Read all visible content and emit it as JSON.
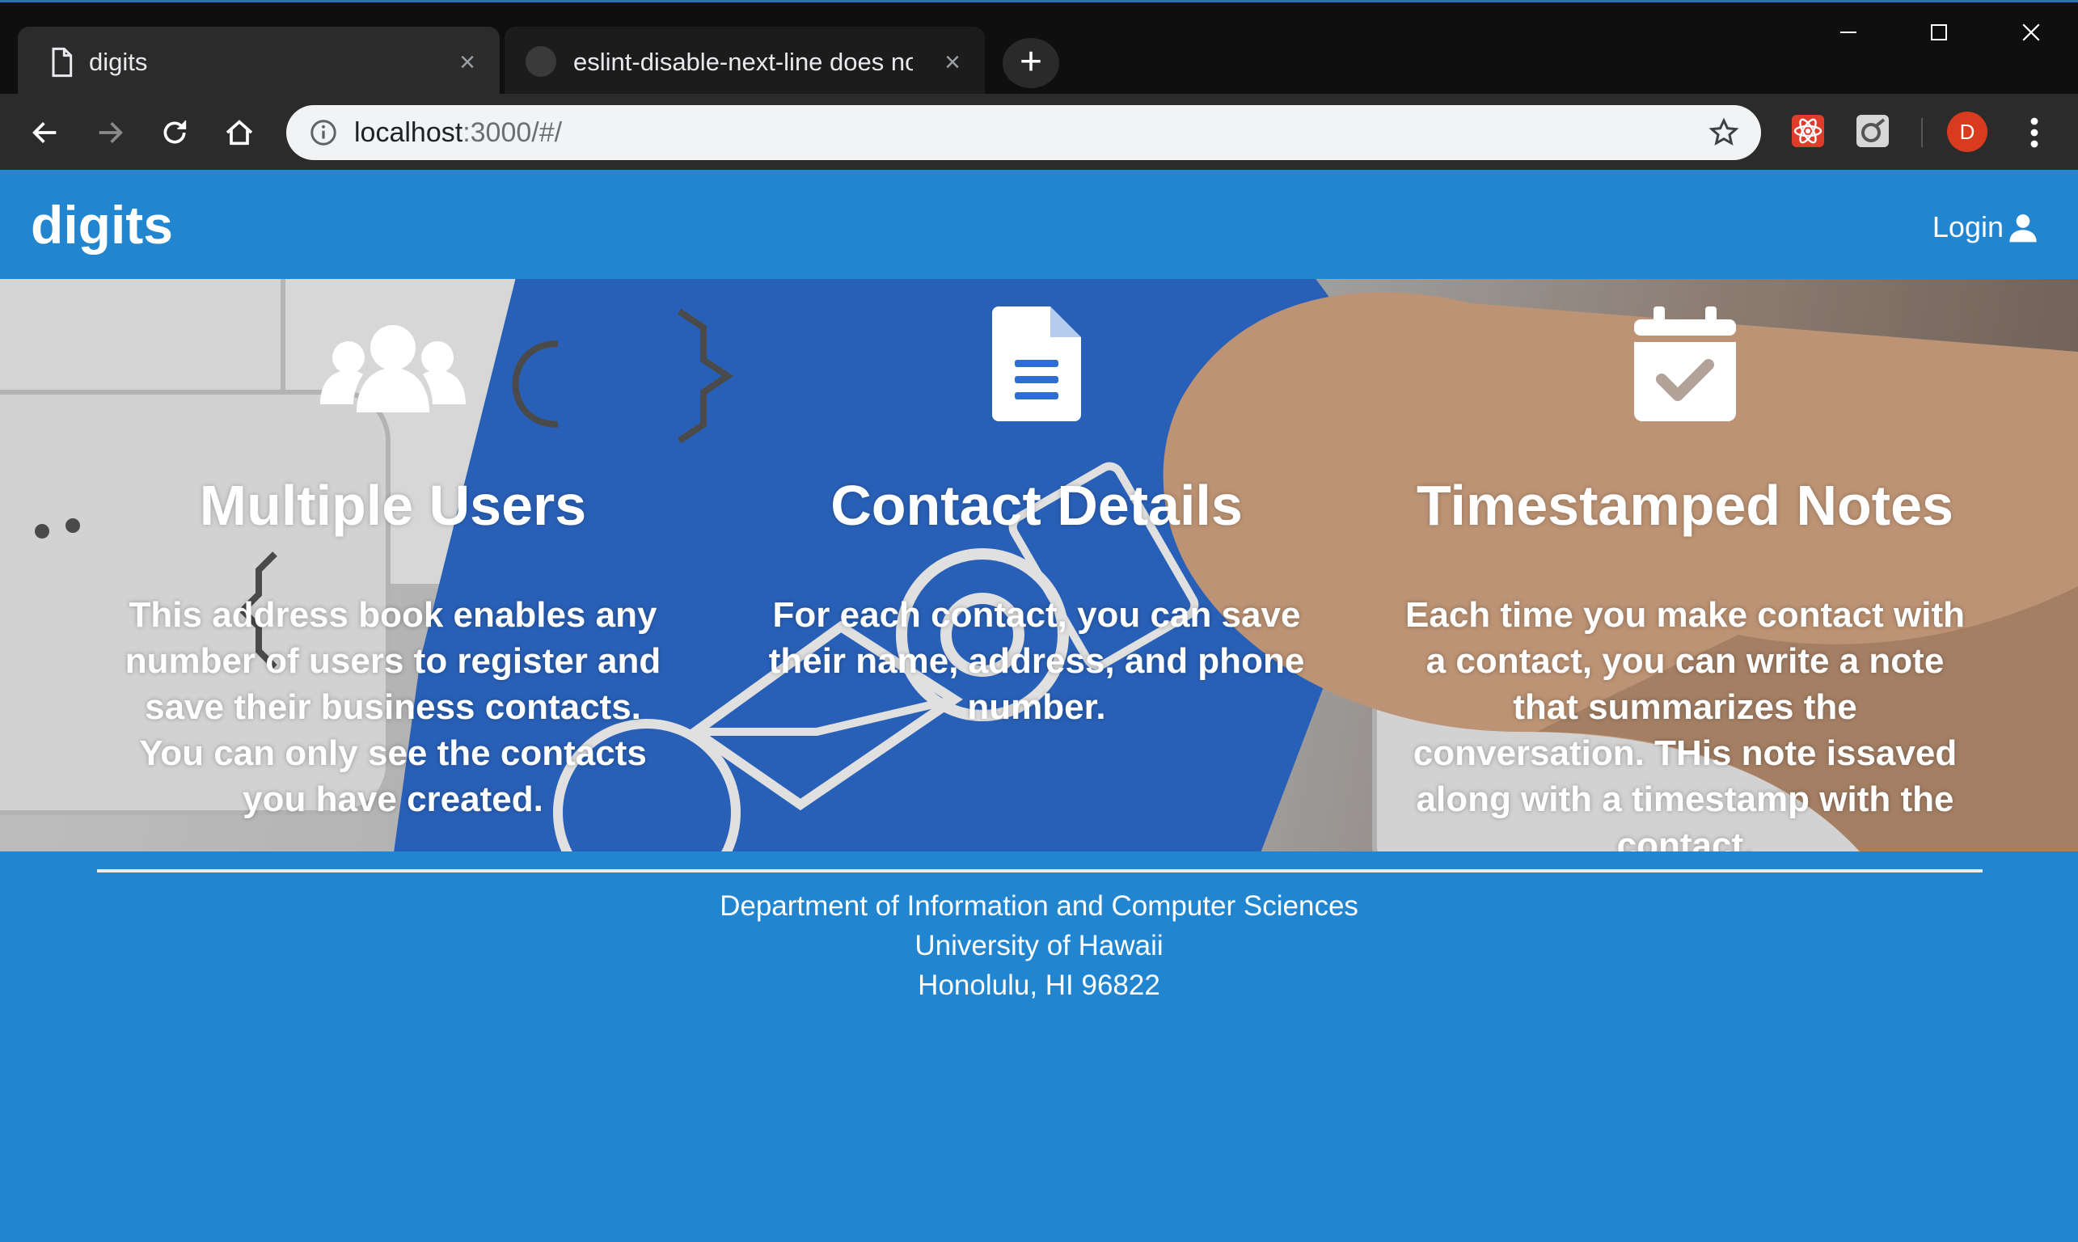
{
  "browser": {
    "tabs": [
      {
        "title": "digits",
        "close": "×"
      },
      {
        "title": "eslint-disable-next-line does not",
        "close": "×"
      }
    ],
    "new_tab": "+",
    "url_host": "localhost",
    "url_path": ":3000/#/",
    "profile_initial": "D"
  },
  "navbar": {
    "brand": "digits",
    "login_label": "Login"
  },
  "features": [
    {
      "icon": "users-icon",
      "title": "Multiple Users",
      "description": "This address book enables any number of users to register and save their business contacts. You can only see the contacts you have created."
    },
    {
      "icon": "file-text-icon",
      "title": "Contact Details",
      "description": "For each contact, you can save their name, address, and phone number."
    },
    {
      "icon": "calendar-check-icon",
      "title": "Timestamped Notes",
      "description": "Each time you make contact with a contact, you can write a note that summarizes the conversation. THis note issaved along with a timestamp with the contact."
    }
  ],
  "footer": {
    "line1": "Department of Information and Computer Sciences",
    "line2": "University of Hawaii",
    "line3": "Honolulu, HI 96822"
  },
  "colors": {
    "primary": "#2185d0",
    "chrome_dark": "#1f1f1f",
    "key_blue": "#2f6ed1"
  }
}
